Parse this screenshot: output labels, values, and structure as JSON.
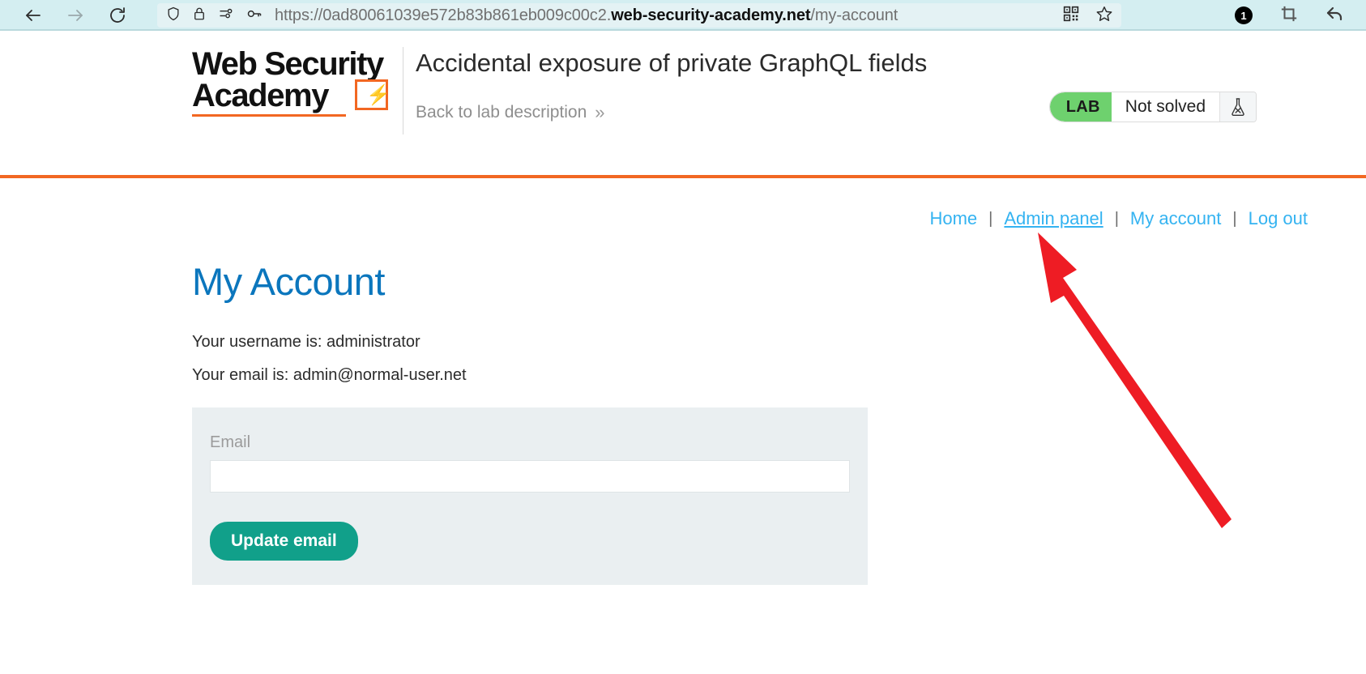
{
  "browser": {
    "back_icon": "back-arrow-icon",
    "forward_icon": "forward-arrow-icon",
    "reload_icon": "reload-icon",
    "shield_icon": "shield-icon",
    "lock_icon": "padlock-icon",
    "permissions_icon": "permissions-icon",
    "key_icon": "key-icon",
    "qr_icon": "qr-code-icon",
    "bookmark_icon": "star-icon",
    "extension_badge_count": "1",
    "crop_icon": "crop-icon",
    "undo_icon": "undo-arrow-icon",
    "url_prefix": "https://0ad80061039e572b83b861eb009c00c2.",
    "url_domain": "web-security-academy.net",
    "url_path": "/my-account",
    "url_full": "https://0ad80061039e572b83b861eb009c00c2.web-security-academy.net/my-account"
  },
  "header": {
    "logo_line1": "Web Security",
    "logo_line2": "Academy",
    "logo_mark": "⚡",
    "lab_title": "Accidental exposure of private GraphQL fields",
    "back_link": "Back to lab description",
    "back_chevron": "»",
    "lab_tag": "LAB",
    "lab_state": "Not solved",
    "flask_icon": "flask-icon",
    "status_color": "#6ed16e",
    "accent_color": "#f26722"
  },
  "nav": {
    "items": [
      {
        "label": "Home",
        "hovered": false
      },
      {
        "label": "Admin panel",
        "hovered": true
      },
      {
        "label": "My account",
        "hovered": false
      },
      {
        "label": "Log out",
        "hovered": false
      }
    ],
    "separator": "|",
    "link_color": "#34b3f1"
  },
  "main": {
    "page_title": "My Account",
    "username_line": "Your username is: administrator",
    "email_line": "Your email is: admin@normal-user.net",
    "form": {
      "email_label": "Email",
      "email_value": "",
      "email_placeholder": "",
      "submit_label": "Update email",
      "submit_color": "#11a08a"
    }
  },
  "annotation": {
    "arrow_color": "#ee1c24",
    "points_to": "Admin panel"
  }
}
